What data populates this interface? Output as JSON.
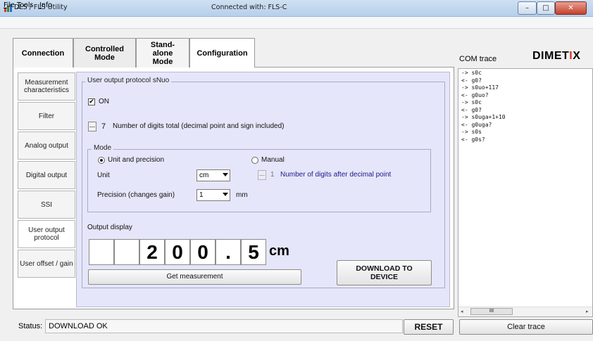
{
  "window": {
    "title": "DLS / FLS Utility",
    "connection": "Connected with: FLS-C",
    "controls": {
      "minimize": "–",
      "maximize": "□",
      "close": "✕"
    }
  },
  "menu": [
    "File",
    "Tools",
    "Info"
  ],
  "main_tabs": [
    {
      "label": "Connection"
    },
    {
      "label": "Controlled Mode"
    },
    {
      "label": "Stand-alone Mode"
    },
    {
      "label": "Configuration",
      "active": true
    }
  ],
  "side_tabs": [
    {
      "label": "Measurement characteristics"
    },
    {
      "label": "Filter"
    },
    {
      "label": "Analog output"
    },
    {
      "label": "Digital output"
    },
    {
      "label": "SSI"
    },
    {
      "label": "User output protocol",
      "active": true
    },
    {
      "label": "User offset / gain"
    }
  ],
  "protocol": {
    "group_title": "User output protocol sNuo",
    "on_label": "ON",
    "on_checked": true,
    "digits_total": "7",
    "digits_total_label": "Number of digits total (decimal point and sign included)",
    "mode": {
      "title": "Mode",
      "unit_precision_label": "Unit and precision",
      "manual_label": "Manual",
      "selected": "unit_precision",
      "unit_label": "Unit",
      "unit_value": "cm",
      "decimal_digits": "1",
      "decimal_digits_label": "Number of digits after decimal point",
      "precision_label": "Precision (changes gain)",
      "precision_value": "1",
      "precision_unit": "mm"
    },
    "output_display": {
      "title": "Output display",
      "digits": [
        "",
        "",
        "2",
        "0",
        "0",
        ".",
        "5"
      ],
      "unit": "cm"
    },
    "get_measurement": "Get measurement",
    "download": "DOWNLOAD TO DEVICE"
  },
  "com_trace": {
    "title": "COM trace",
    "brand": "DIMETIX",
    "lines": [
      "-> s0c",
      "<- g0?",
      "-> s0uo+117",
      "<- g0uo?",
      "-> s0c",
      "<- g0?",
      "-> s0uga+1+10",
      "<- g0uga?",
      "-> s0s",
      "<- g0s?"
    ],
    "scroll_thumb": "III",
    "clear_button": "Clear trace"
  },
  "status": {
    "label": "Status:",
    "value": "DOWNLOAD OK",
    "reset_button": "RESET"
  }
}
